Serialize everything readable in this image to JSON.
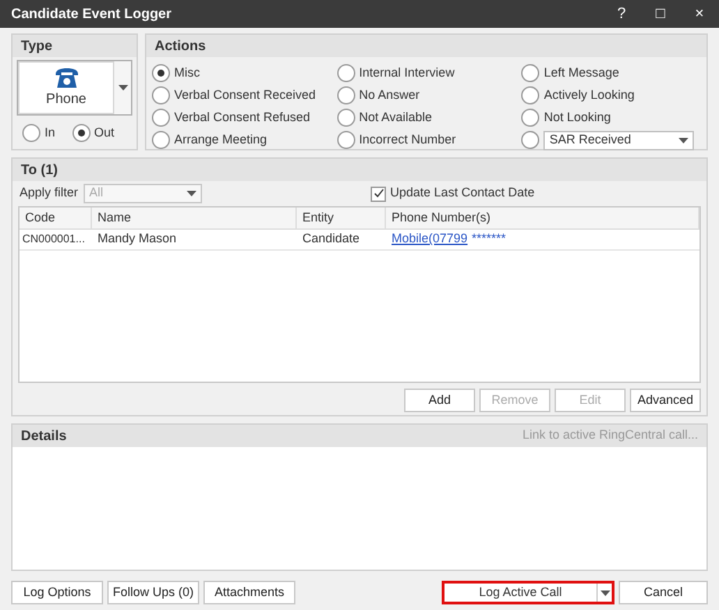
{
  "window": {
    "title": "Candidate Event Logger",
    "controls": [
      "?",
      "□",
      "×"
    ]
  },
  "type_group": {
    "title": "Type",
    "button": {
      "label": "Phone"
    },
    "directions": [
      {
        "label": "In",
        "selected": false
      },
      {
        "label": "Out",
        "selected": true
      }
    ]
  },
  "actions": {
    "title": "Actions",
    "options": [
      {
        "label": "Misc",
        "selected": true,
        "kind": "radio"
      },
      {
        "label": "Internal Interview",
        "selected": false,
        "kind": "radio"
      },
      {
        "label": "Left Message",
        "selected": false,
        "kind": "radio"
      },
      {
        "label": "Verbal Consent Received",
        "selected": false,
        "kind": "radio"
      },
      {
        "label": "No Answer",
        "selected": false,
        "kind": "radio"
      },
      {
        "label": "Actively Looking",
        "selected": false,
        "kind": "radio"
      },
      {
        "label": "Verbal Consent Refused",
        "selected": false,
        "kind": "radio"
      },
      {
        "label": "Not Available",
        "selected": false,
        "kind": "radio"
      },
      {
        "label": "Not Looking",
        "selected": false,
        "kind": "radio"
      },
      {
        "label": "Arrange Meeting",
        "selected": false,
        "kind": "radio"
      },
      {
        "label": "Incorrect Number",
        "selected": false,
        "kind": "radio"
      },
      {
        "label": "SAR Received",
        "selected": false,
        "kind": "dropdown"
      }
    ]
  },
  "to": {
    "title": "To (1)",
    "filter_label": "Apply filter",
    "filter_value": "All",
    "update_last_contact": {
      "label": "Update Last Contact Date",
      "checked": true
    },
    "table": {
      "columns": [
        "Code",
        "Name",
        "Entity",
        "Phone Number(s)"
      ],
      "rows": [
        {
          "code": "CN000001...",
          "name": "Mandy Mason",
          "entity": "Candidate",
          "phone_link": "Mobile(07799",
          "phone_masked": "*******"
        }
      ]
    },
    "buttons": [
      {
        "label": "Add",
        "disabled": false
      },
      {
        "label": "Remove",
        "disabled": true
      },
      {
        "label": "Edit",
        "disabled": true
      },
      {
        "label": "Advanced",
        "disabled": false
      }
    ]
  },
  "details": {
    "title": "Details",
    "link": "Link to active RingCentral call..."
  },
  "footer": {
    "left_buttons": [
      "Log Options",
      "Follow Ups (0)",
      "Attachments"
    ],
    "primary": {
      "label": "Log Active Call",
      "highlighted": true
    },
    "cancel": "Cancel"
  }
}
